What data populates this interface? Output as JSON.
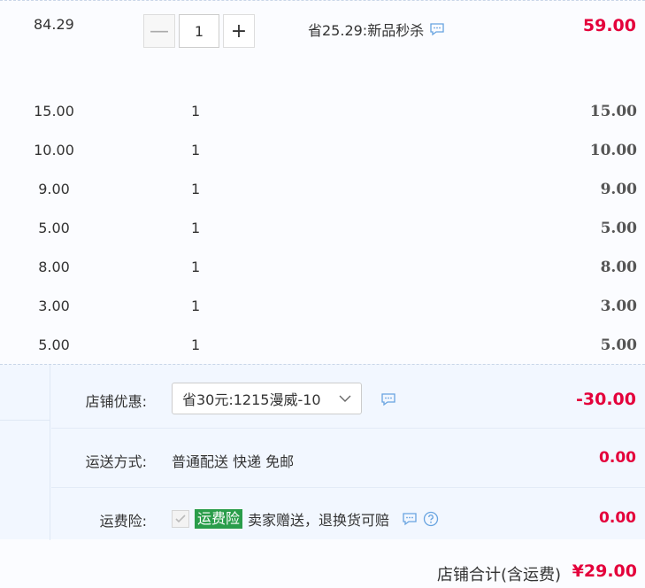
{
  "item": {
    "unit_price": "84.29",
    "quantity": "1",
    "minus_symbol": "—",
    "plus_symbol": "+",
    "promo_text": "省25.29:新品秒杀",
    "subtotal": "59.00"
  },
  "rows": [
    {
      "price": "15.00",
      "qty": "1",
      "total": "15.00"
    },
    {
      "price": "10.00",
      "qty": "1",
      "total": "10.00"
    },
    {
      "price": "9.00",
      "qty": "1",
      "total": "9.00"
    },
    {
      "price": "5.00",
      "qty": "1",
      "total": "5.00"
    },
    {
      "price": "8.00",
      "qty": "1",
      "total": "8.00"
    },
    {
      "price": "3.00",
      "qty": "1",
      "total": "3.00"
    },
    {
      "price": "5.00",
      "qty": "1",
      "total": "5.00"
    }
  ],
  "shop_discount": {
    "label": "店铺优惠:",
    "selected": "省30元:1215漫威-10",
    "amount": "-30.00"
  },
  "shipping": {
    "label": "运送方式:",
    "method": "普通配送 快递 免邮",
    "amount": "0.00"
  },
  "insurance": {
    "label": "运费险:",
    "badge": "运费险",
    "text": "卖家赠送，退换货可赔",
    "amount": "0.00",
    "checked": true
  },
  "footer": {
    "total_label": "店铺合计(含运费)",
    "total_amount": "¥29.00"
  },
  "colors": {
    "price_red": "#e4003b",
    "badge_green": "#2a9d4a",
    "icon_blue": "#67a3e0"
  }
}
